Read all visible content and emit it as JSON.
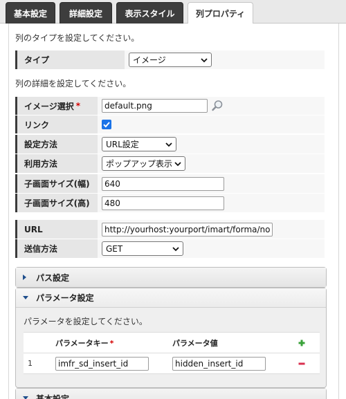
{
  "tabs": [
    {
      "label": "基本設定",
      "active": false
    },
    {
      "label": "詳細設定",
      "active": false
    },
    {
      "label": "表示スタイル",
      "active": false
    },
    {
      "label": "列プロパティ",
      "active": true
    }
  ],
  "type_section": {
    "note": "列のタイプを設定してください。",
    "type_label": "タイプ",
    "type_value": "イメージ"
  },
  "detail_section": {
    "note": "列の詳細を設定してください。",
    "image_label": "イメージ選択",
    "required_mark": "*",
    "image_value": "default.png",
    "link_label": "リンク",
    "link_checked": true,
    "method_label": "設定方法",
    "method_value": "URL設定",
    "usage_label": "利用方法",
    "usage_value": "ポップアップ表示",
    "width_label": "子画面サイズ(幅)",
    "width_value": "640",
    "height_label": "子画面サイズ(高)",
    "height_value": "480",
    "url_label": "URL",
    "url_value": "http://yourhost:yourport/imart/forma/normal/vi",
    "send_label": "送信方法",
    "send_value": "GET"
  },
  "path_accordion": {
    "title": "パス設定",
    "expanded": false
  },
  "param_accordion": {
    "title": "パラメータ設定",
    "expanded": true,
    "note": "パラメータを設定してください。",
    "col_key": "パラメータキー",
    "required_mark": "*",
    "col_value": "パラメータ値",
    "rows": [
      {
        "index": "1",
        "key": "imfr_sd_insert_id",
        "value": "hidden_insert_id"
      }
    ]
  },
  "basic_accordion": {
    "title": "基本設定",
    "expanded": true
  },
  "colors": {
    "tab_dark": "#3d3d3d",
    "label_bg": "#e6e6e6",
    "accent_green": "#3aa23a",
    "accent_red": "#d9304f",
    "checkbox_blue": "#1a73e8"
  }
}
